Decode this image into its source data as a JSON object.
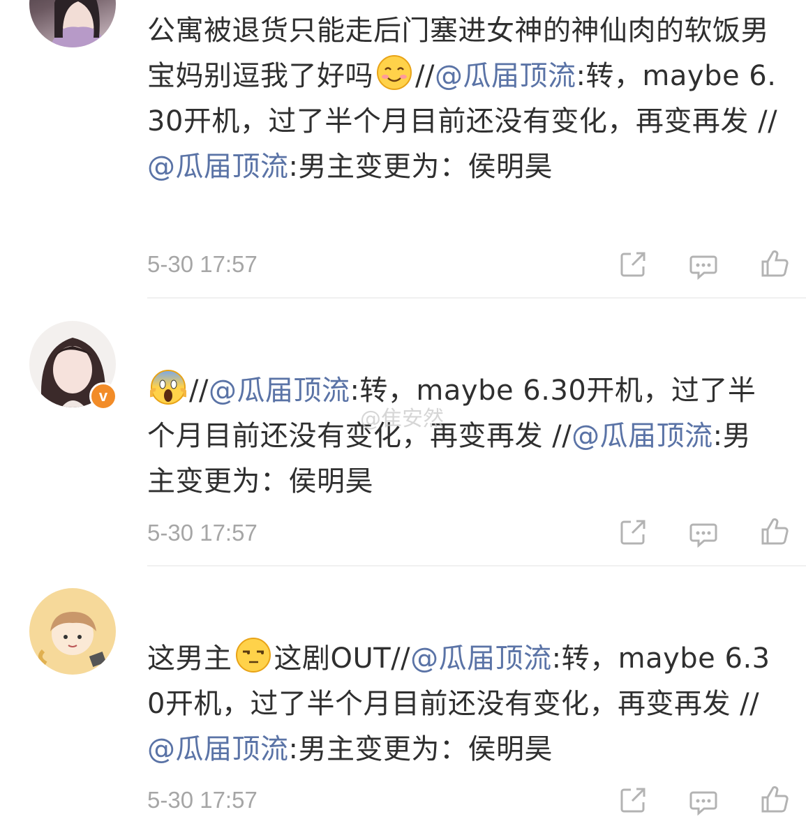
{
  "comments": [
    {
      "id": "c1",
      "segments": [
        {
          "type": "text",
          "value": "公寓被退货只能走后门塞进女神的神仙肉的软饭男宝妈别逗我了好吗"
        },
        {
          "type": "emoji",
          "name": "smile-emoji"
        },
        {
          "type": "text",
          "value": "//"
        },
        {
          "type": "mention",
          "value": "@瓜届顶流"
        },
        {
          "type": "text",
          "value": ":转，maybe 6.30开机，过了半个月目前还没有变化，再变再发 //"
        },
        {
          "type": "mention",
          "value": "@瓜届顶流"
        },
        {
          "type": "text",
          "value": ":男主变更为：侯明昊"
        }
      ],
      "time": "5-30 17:57"
    },
    {
      "id": "c2",
      "verified_badge": "v",
      "segments": [
        {
          "type": "emoji",
          "name": "scream-emoji"
        },
        {
          "type": "text",
          "value": "//"
        },
        {
          "type": "mention",
          "value": "@瓜届顶流"
        },
        {
          "type": "text",
          "value": ":转，maybe 6.30开机，过了半个月目前还没有变化，再变再发 //"
        },
        {
          "type": "mention",
          "value": "@瓜届顶流"
        },
        {
          "type": "text",
          "value": ":男主变更为：侯明昊"
        }
      ],
      "time": "5-30 17:57"
    },
    {
      "id": "c3",
      "segments": [
        {
          "type": "text",
          "value": "这男主"
        },
        {
          "type": "emoji",
          "name": "unamused-emoji"
        },
        {
          "type": "text",
          "value": "这剧OUT//"
        },
        {
          "type": "mention",
          "value": "@瓜届顶流"
        },
        {
          "type": "text",
          "value": ":转，maybe 6.30开机，过了半个月目前还没有变化，再变再发 //"
        },
        {
          "type": "mention",
          "value": "@瓜届顶流"
        },
        {
          "type": "text",
          "value": ":男主变更为：侯明昊"
        }
      ],
      "time": "5-30 17:57"
    }
  ],
  "watermark": "@隹安然",
  "colors": {
    "mention": "#5a73a6",
    "text": "#2f2f2f",
    "meta": "#a6a6a6",
    "badge": "#f28c28"
  },
  "icons": [
    "share-icon",
    "comment-icon",
    "like-icon"
  ]
}
